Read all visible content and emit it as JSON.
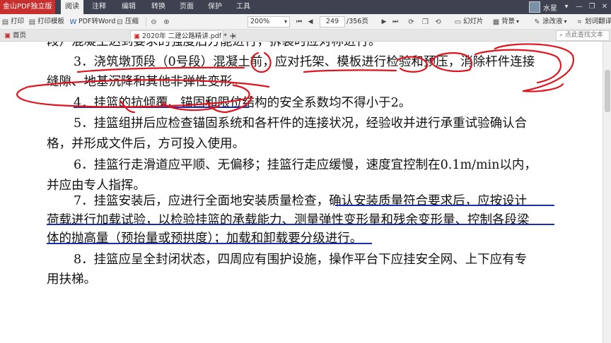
{
  "app": {
    "title": "金山PDF独立版",
    "menu": [
      "阅读",
      "注释",
      "编辑",
      "转换",
      "页面",
      "保护",
      "工具"
    ],
    "active_menu": "阅读",
    "user_name": "水星",
    "window_controls": [
      "▾",
      "—",
      "❐",
      "✕"
    ]
  },
  "toolbar": {
    "print": "打印",
    "print_template": "打印模板",
    "pdf_to_word": "PDF转Word",
    "compress": "压缩",
    "zoom": "200%",
    "page_current": "249",
    "page_total": "/356页",
    "slideshow": "幻灯片",
    "background": "背景",
    "smear": "涂改液",
    "translate": "划词翻译"
  },
  "tabs": {
    "home": "首页",
    "document": "2020年 二建公路精讲.pdf *",
    "add": "+",
    "search_placeholder": "点此查找文本"
  },
  "document": {
    "lines": [
      "段）混凝土达到要求的强度后方能进行，拆装时应对称进行。",
      "3．浇筑墩顶段（0号段）混凝土前，应对托架、模板进行检验和预压，消除杆件连接",
      "缝隙、地基沉降和其他非弹性变形。",
      "4．挂篮的抗倾覆、锚固和限位结构的安全系数均不得小于2。",
      "5．挂篮组拼后应检查锚固系统和各杆件的连接状况，经验收并进行承重试验确认合",
      "格，并形成文件后，方可投入使用。",
      "6．挂篮行走滑道应平顺、无偏移；挂篮行走应缓慢，速度宜控制在0.1m/min以内，",
      "并应由专人指挥。",
      "7．挂篮安装后，应进行全面地安装质量检查，确认安装质量符合要求后，应按设计",
      "荷载进行加载试验，以检验挂篮的承载能力、测量弹性变形量和残余变形量、控制各段梁",
      "体的抛高量（预抬量或预拱度）；加载和卸载要分级进行。",
      "8．挂篮应呈全封闭状态，四周应有围护设施，操作平台下应挂安全网、上下应有专",
      "用扶梯。"
    ]
  },
  "colors": {
    "menubar": "#3d4150",
    "app_title_bg": "#c8302e",
    "ink_red": "#e0141e",
    "ink_blue": "#1a2fb0"
  }
}
